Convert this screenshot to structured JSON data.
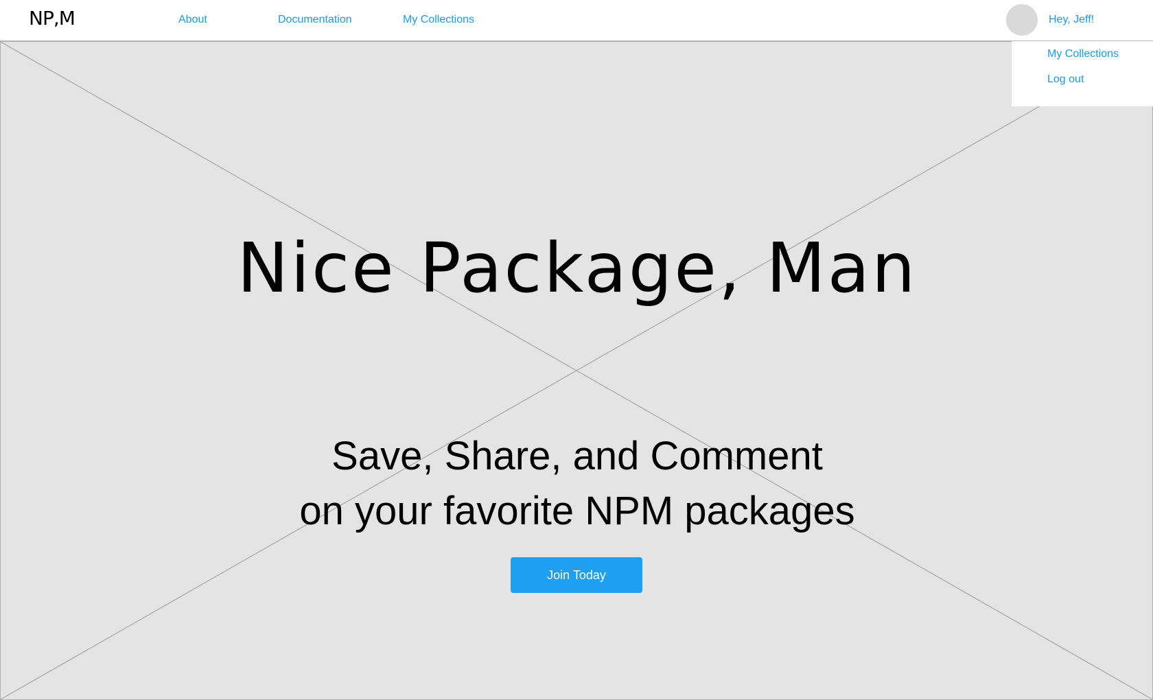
{
  "brand": {
    "logo_text": "NP,M"
  },
  "nav": {
    "items": [
      {
        "label": "About"
      },
      {
        "label": "Documentation"
      },
      {
        "label": "My Collections"
      }
    ]
  },
  "user": {
    "greeting": "Hey, Jeff!",
    "avatar_icon": "avatar-placeholder-icon"
  },
  "user_menu": {
    "items": [
      {
        "label": "My Collections"
      },
      {
        "label": "Log out"
      }
    ]
  },
  "hero": {
    "title": "Nice Package, Man",
    "subtitle_line1": "Save, Share, and Comment",
    "subtitle_line2": "on your favorite NPM packages",
    "cta_label": "Join Today",
    "image_placeholder_icon": "image-placeholder-x"
  },
  "colors": {
    "link": "#1a9be6",
    "button": "#1e9ff2",
    "placeholder_bg": "#e4e4e4"
  }
}
